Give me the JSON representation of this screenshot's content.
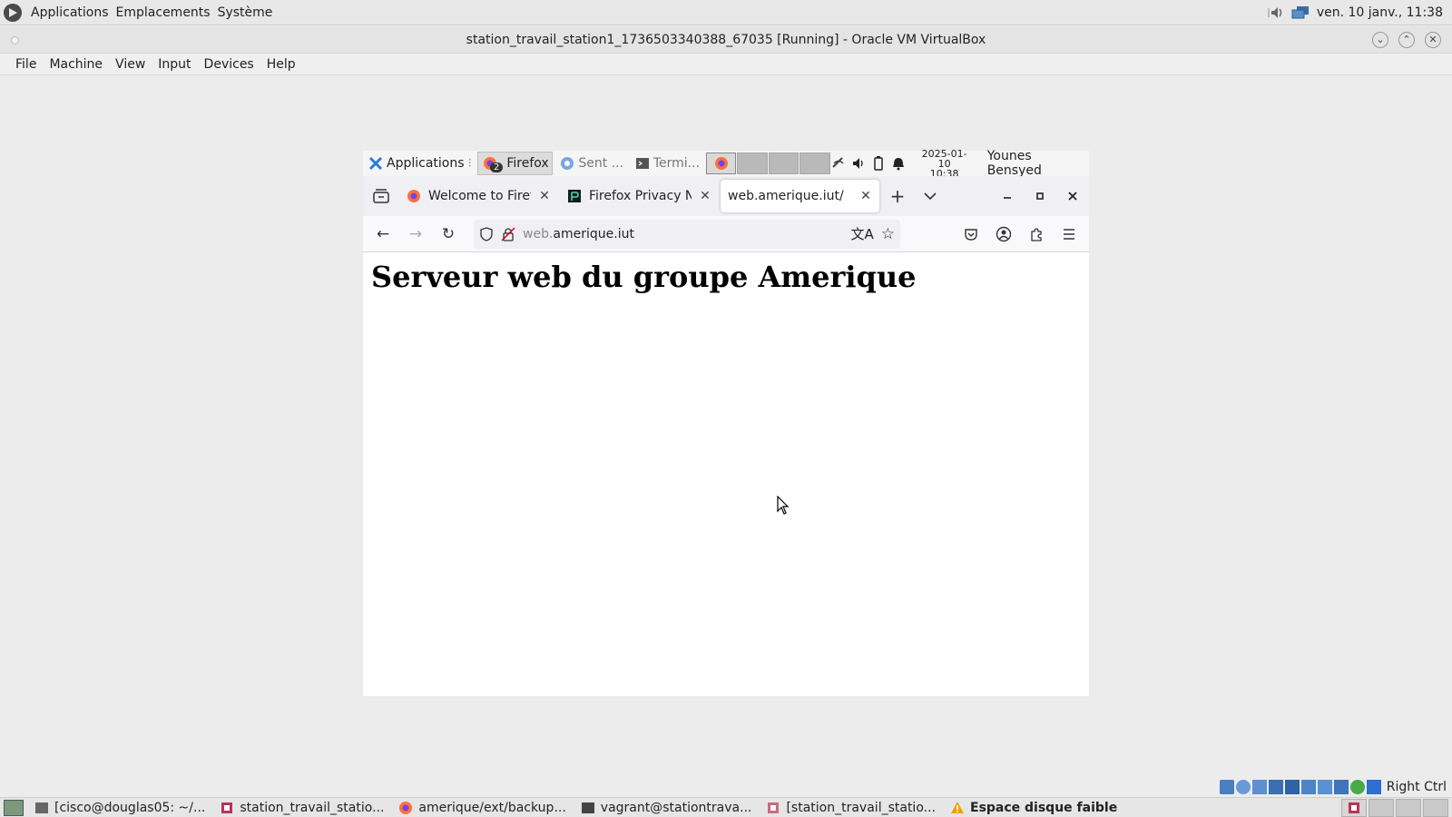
{
  "host_panel": {
    "menus": [
      "Applications",
      "Emplacements",
      "Système"
    ],
    "clock": "ven. 10 janv., 11:38",
    "icons": [
      "distro-logo-icon",
      "volume-icon",
      "network-icon"
    ]
  },
  "vbox": {
    "window_title": "station_travail_station1_1736503340388_67035 [Running] - Oracle VM VirtualBox",
    "menus": [
      "File",
      "Machine",
      "View",
      "Input",
      "Devices",
      "Help"
    ],
    "host_key": "Right Ctrl"
  },
  "guest_panel": {
    "apps_label": "Applications",
    "tasks": [
      {
        "label": "Firefox",
        "badge": "2",
        "active": true
      },
      {
        "label": "Sent ...",
        "active": false
      },
      {
        "label": "Termi...",
        "active": false
      }
    ],
    "clock_date": "2025-01-10",
    "clock_time": "10:38",
    "user": "Younes Bensyed"
  },
  "firefox": {
    "tabs": [
      {
        "label": "Welcome to Firefo",
        "active": false
      },
      {
        "label": "Firefox Privacy No",
        "active": false
      },
      {
        "label": "web.amerique.iut/",
        "active": true
      }
    ],
    "url_dim": "web.",
    "url_host": "amerique.iut",
    "page_heading": "Serveur web du groupe Amerique"
  },
  "taskbar": {
    "items": [
      {
        "label": "[cisco@douglas05: ~/...",
        "icon": "terminal-icon"
      },
      {
        "label": "station_travail_statio...",
        "icon": "virtualbox-icon"
      },
      {
        "label": "amerique/ext/backup...",
        "icon": "firefox-icon"
      },
      {
        "label": "vagrant@stationtrava...",
        "icon": "terminal-icon"
      },
      {
        "label": "[station_travail_statio...",
        "icon": "virtualbox-icon"
      },
      {
        "label": "Espace disque faible",
        "icon": "warning-icon",
        "bold": true
      }
    ]
  },
  "colors": {
    "firefox_orange": "#ff7139",
    "firefox_purple": "#7542e5",
    "warning": "#f0a000",
    "heading": "#000000"
  }
}
